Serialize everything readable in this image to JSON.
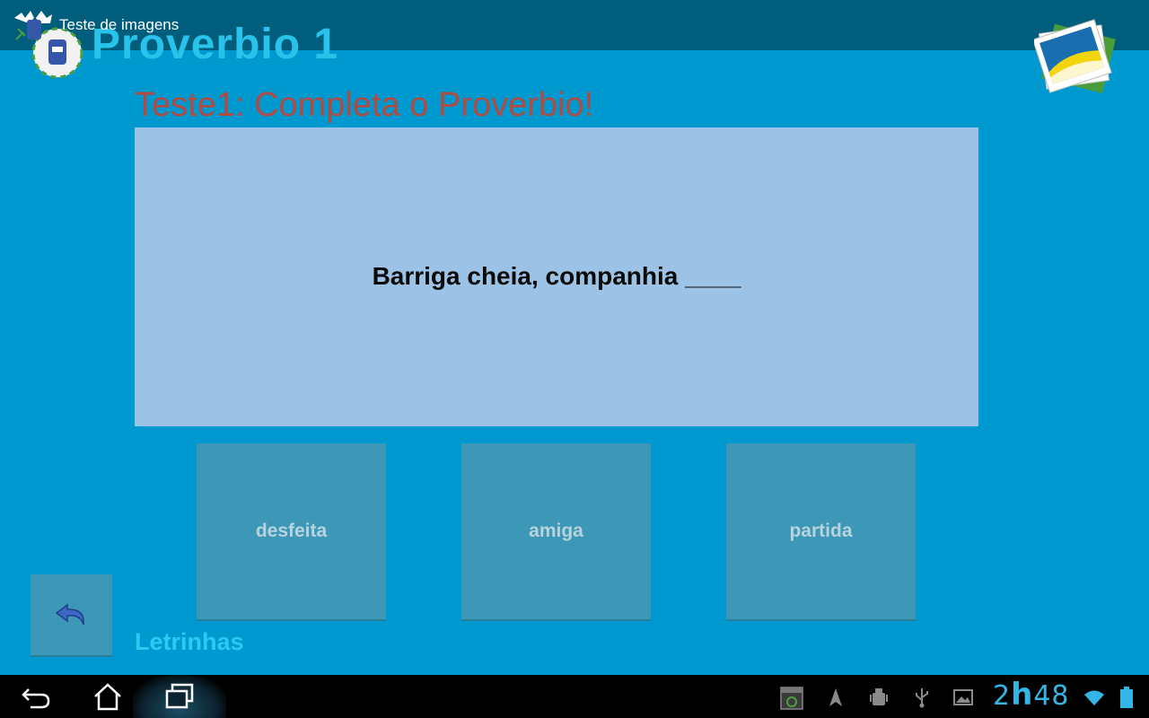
{
  "titlebar": {
    "app_title": "Teste de imagens"
  },
  "header": {
    "title": "Proverbio 1"
  },
  "quiz": {
    "subtitle": "Teste1: Completa o Proverbio!",
    "question": "Barriga cheia, companhia ____",
    "answers": [
      "desfeita",
      "amiga",
      "partida"
    ]
  },
  "footer": {
    "label": "Letrinhas"
  },
  "status": {
    "clock_hour": "2",
    "clock_h": "h",
    "clock_minutes": "48"
  },
  "icons": {
    "app": "app-logo-icon",
    "gallery": "photo-gallery-icon",
    "back": "undo-arrow-icon",
    "nav": [
      "back-icon",
      "home-icon",
      "recent-apps-icon"
    ],
    "status": [
      "screenshot-icon",
      "navigation-icon",
      "android-debug-icon",
      "usb-icon",
      "image-icon",
      "wifi-icon",
      "battery-icon"
    ]
  },
  "colors": {
    "background": "#0099cf",
    "titlebar": "#005e7c",
    "title": "#28c3ea",
    "subtitle": "#b34a3f",
    "panel": "#9cc3e5",
    "answer_tile": "#3c98b6",
    "footer_label": "#2ccaf3",
    "clock": "#33b5e5"
  }
}
